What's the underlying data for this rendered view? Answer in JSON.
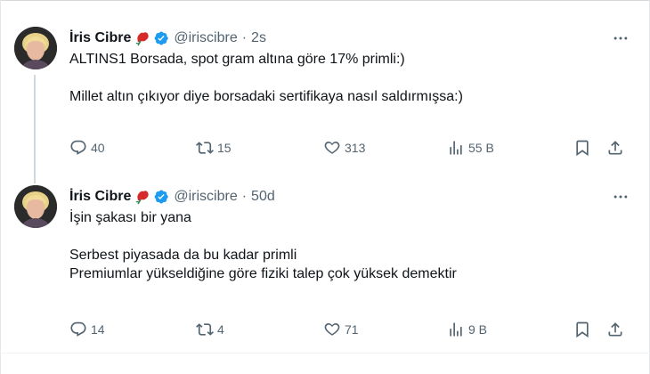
{
  "tweets": [
    {
      "author": "İris Cibre",
      "handle": "@iriscibre",
      "time": "2s",
      "lines": [
        "ALTINS1 Borsada, spot gram altına göre 17% primli:)",
        "",
        "Millet altın çıkıyor diye borsadaki sertifikaya nasıl saldırmışsa:)"
      ],
      "stats": {
        "replies": "40",
        "retweets": "15",
        "likes": "313",
        "views": "55 B"
      }
    },
    {
      "author": "İris Cibre",
      "handle": "@iriscibre",
      "time": "50d",
      "lines": [
        "İşin şakası bir yana",
        "",
        "Serbest piyasada da bu kadar primli",
        "Premiumlar yükseldiğine göre fiziki talep çok yüksek demektir"
      ],
      "stats": {
        "replies": "14",
        "retweets": "4",
        "likes": "71",
        "views": "9 B"
      }
    }
  ],
  "separator": "·",
  "icons": {
    "verified": "verified-badge-icon",
    "rose": "red-rose-emoji-icon",
    "more": "more-horizontal-icon",
    "reply": "reply-icon",
    "retweet": "retweet-icon",
    "like": "heart-icon",
    "views": "views-chart-icon",
    "bookmark": "bookmark-icon",
    "share": "share-icon"
  },
  "colors": {
    "text": "#0f1419",
    "secondary": "#536471",
    "verified": "#1d9bf0",
    "rose": "#d62a2a",
    "thread_line": "#cfd9de"
  }
}
